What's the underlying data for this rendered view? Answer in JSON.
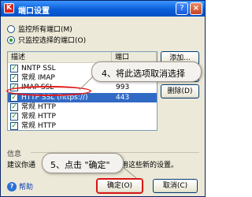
{
  "window": {
    "title": "端口设置",
    "app_icon": "K",
    "help_glyph": "?",
    "close_glyph": "×"
  },
  "options": {
    "monitor_all": "监控所有端口(M)",
    "monitor_selected": "只监控选择的端口(O)",
    "selected": "monitor_selected"
  },
  "table": {
    "headers": {
      "desc": "描述",
      "port": "端口"
    },
    "rows": [
      {
        "name": "NNTP SSL",
        "port": "",
        "checked": true,
        "selected": false
      },
      {
        "name": "常规 IMAP",
        "port": "",
        "checked": true,
        "selected": false
      },
      {
        "name": "IMAP SSL",
        "port": "993",
        "checked": true,
        "selected": false
      },
      {
        "name": "HTTP SSL (https://)",
        "port": "443",
        "checked": true,
        "selected": true
      },
      {
        "name": "常规 HTTP",
        "port": "",
        "checked": true,
        "selected": false
      },
      {
        "name": "常规 HTTP",
        "port": "",
        "checked": true,
        "selected": false
      },
      {
        "name": "常规 HTTP",
        "port": "",
        "checked": true,
        "selected": false
      }
    ]
  },
  "buttons": {
    "add": "添加...",
    "edit": "",
    "remove": "删除(D)",
    "ok": "确定(O)",
    "cancel": "取消(C)"
  },
  "info": {
    "label": "信息",
    "text_head": "建议你通",
    "text_tail": "应用这些新的设置。"
  },
  "help": {
    "label": "帮助"
  },
  "callouts": {
    "step4": "4、将此选项取消选择",
    "step5": "5、点击 \"确定\""
  },
  "colors": {
    "annotation_red": "#e01a1a",
    "selection_blue": "#316ac5",
    "titlebar_blue": "#0a5fd8"
  }
}
